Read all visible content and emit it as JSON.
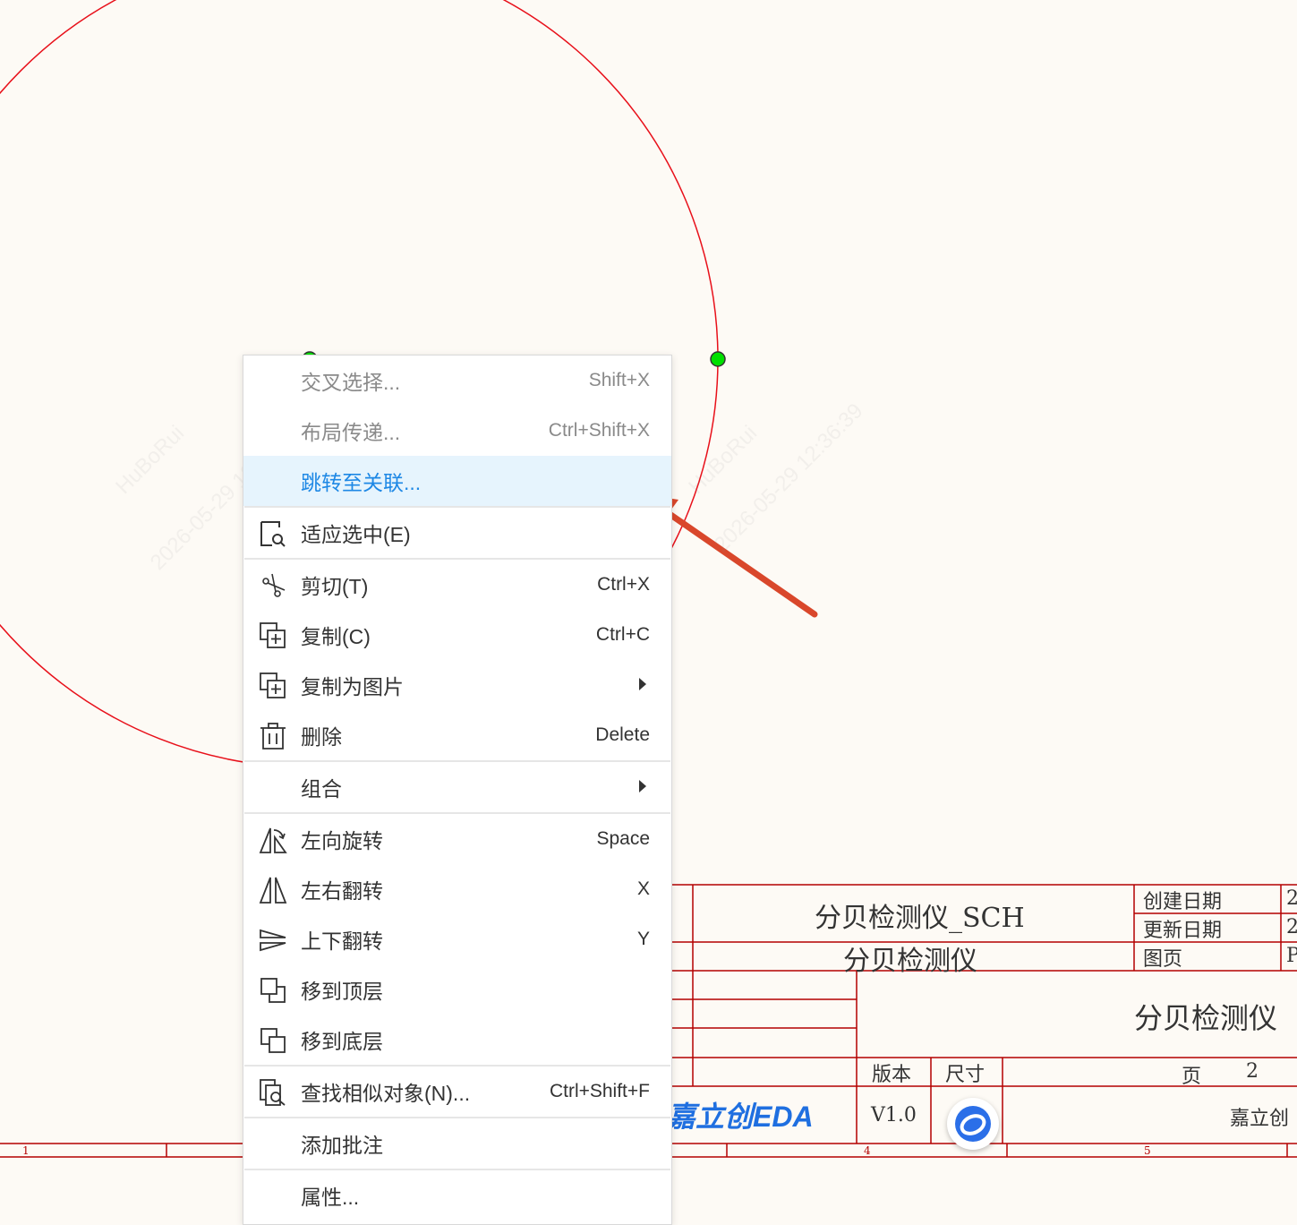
{
  "canvas": {
    "watermarks": [
      "HuBoRui",
      "2026-05-29 12:36:39"
    ],
    "logo_text": "嘉立创EDA"
  },
  "title_block": {
    "project_name": "分贝检测仪_SCH",
    "sheet_name": "分贝检测仪",
    "created_label": "创建日期",
    "created_value": "2",
    "updated_label": "更新日期",
    "updated_value": "2",
    "page_label": "图页",
    "page_value": "P",
    "big_title": "分贝检测仪",
    "version_label": "版本",
    "size_label": "尺寸",
    "page_num_label": "页",
    "page_num_value": "2",
    "version_value": "V1.0",
    "company": "嘉立创",
    "ruler": [
      "1",
      "4",
      "5"
    ]
  },
  "context_menu": {
    "items": [
      {
        "label": "交叉选择...",
        "shortcut": "Shift+X",
        "state": "disabled"
      },
      {
        "label": "布局传递...",
        "shortcut": "Ctrl+Shift+X",
        "state": "disabled"
      },
      {
        "label": "跳转至关联...",
        "shortcut": "",
        "state": "active"
      },
      {
        "label": "适应选中(E)",
        "shortcut": "",
        "icon": "fit-selection-icon"
      },
      {
        "label": "剪切(T)",
        "shortcut": "Ctrl+X",
        "icon": "scissors-icon"
      },
      {
        "label": "复制(C)",
        "shortcut": "Ctrl+C",
        "icon": "copy-icon"
      },
      {
        "label": "复制为图片",
        "shortcut": "",
        "icon": "copy-image-icon",
        "submenu": true
      },
      {
        "label": "删除",
        "shortcut": "Delete",
        "icon": "trash-icon"
      },
      {
        "label": "组合",
        "shortcut": "",
        "submenu": true
      },
      {
        "label": "左向旋转",
        "shortcut": "Space",
        "icon": "rotate-left-icon"
      },
      {
        "label": "左右翻转",
        "shortcut": "X",
        "icon": "flip-horizontal-icon"
      },
      {
        "label": "上下翻转",
        "shortcut": "Y",
        "icon": "flip-vertical-icon"
      },
      {
        "label": "移到顶层",
        "shortcut": "",
        "icon": "bring-to-front-icon"
      },
      {
        "label": "移到底层",
        "shortcut": "",
        "icon": "send-to-back-icon"
      },
      {
        "label": "查找相似对象(N)...",
        "shortcut": "Ctrl+Shift+F",
        "icon": "find-similar-icon"
      },
      {
        "label": "添加批注",
        "shortcut": ""
      },
      {
        "label": "属性...",
        "shortcut": ""
      }
    ]
  },
  "colors": {
    "schematic_red": "#cc0000",
    "arc_red": "#e8101a",
    "handle_green": "#00e000",
    "arrow_red": "#d9472b",
    "active_blue": "#1e88e5",
    "active_bg": "#e6f4fd"
  }
}
